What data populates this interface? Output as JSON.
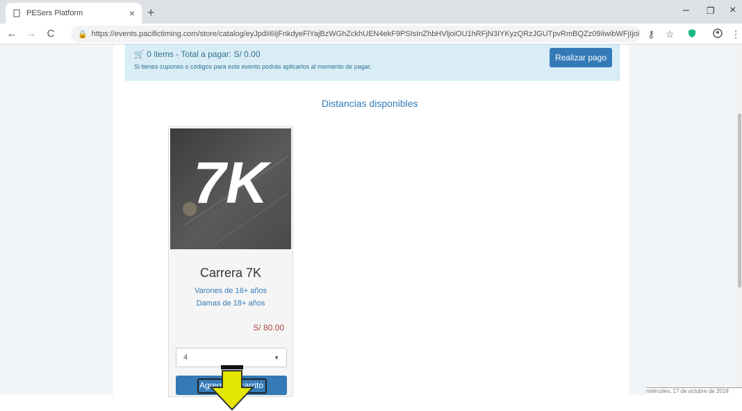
{
  "browser": {
    "tab_title": "PESers Platform",
    "tab_close": "×",
    "new_tab": "+",
    "url": "https://events.pacifictiming.com/store/catalog/eyJpdiI6IjFnkdyeFlYajBzWGhZckhUEN4ekF9PSIsInZhbHVljoiOU1hRFjN3IYKyzQRzJGUTpvRmBQZz09IiwibWFjIjoi77c4...",
    "controls": {
      "minimize": "–",
      "restore": "❐",
      "close": "×"
    },
    "icons": [
      "back-icon",
      "forward-icon",
      "reload-icon",
      "lock-icon",
      "key-icon",
      "star-icon",
      "shield-icon",
      "account-icon",
      "menu-icon"
    ]
  },
  "cart": {
    "summary": "0 items - Total a pagar: S/ 0.00",
    "note": "Si tienes cupones o códigos para este evento podrás aplicarlos al momento de pagar.",
    "pay_button": "Realizar pago"
  },
  "section": {
    "title": "Distancias disponibles"
  },
  "product": {
    "image_text": "7K",
    "title": "Carrera 7K",
    "line1": "Varones de 16+ años",
    "line2": "Damas de 18+ años",
    "price": "S/ 80.00",
    "quantity": "4",
    "add_button": "Agregar al carrito"
  },
  "taskbar": {
    "date": "miércoles, 17 de octubre de 2018"
  },
  "colors": {
    "accent": "#337ab7",
    "info_bg": "#d9edf7",
    "arrow": "#e3e600"
  }
}
